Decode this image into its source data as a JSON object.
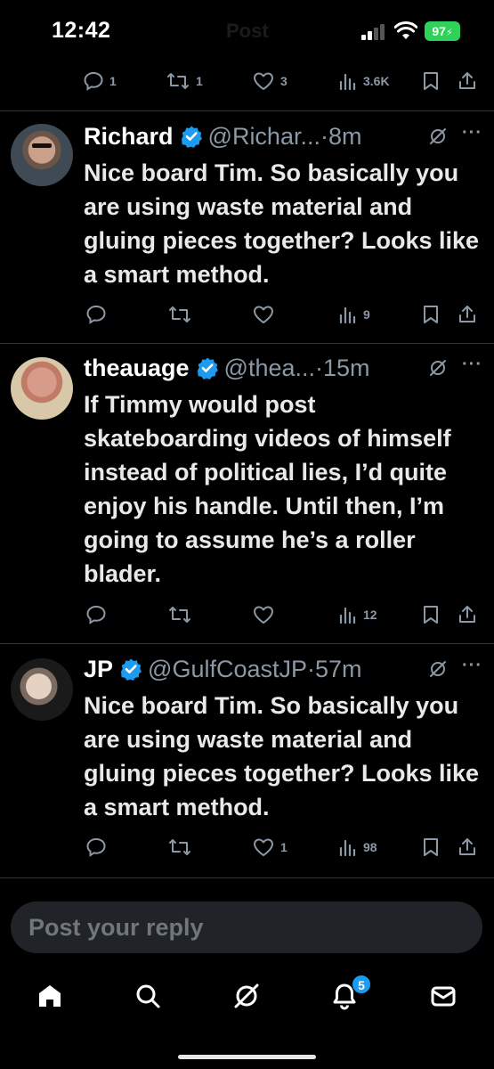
{
  "status_bar": {
    "time": "12:42",
    "ghost_title": "Post",
    "battery": "97",
    "battery_color": "#30d158"
  },
  "colors": {
    "accent": "#1d9bf0",
    "muted": "#8b98a5",
    "background": "#000000"
  },
  "top_post_actions": {
    "replies": "1",
    "reposts": "1",
    "likes": "3",
    "views": "3.6K"
  },
  "replies": [
    {
      "name": "Richard",
      "handle": "@Richar...",
      "time": "·8m",
      "text": "Nice board Tim. So basically you are using waste material and gluing pieces together? Looks like a smart method.",
      "actions": {
        "replies": "",
        "reposts": "",
        "likes": "",
        "views": "9"
      }
    },
    {
      "name": "theauage",
      "handle": "@thea...",
      "time": "·15m",
      "text": "If Timmy would post skateboarding videos of himself instead of political lies, I’d quite enjoy his handle. Until then, I’m going to assume he’s a roller blader.",
      "actions": {
        "replies": "",
        "reposts": "",
        "likes": "",
        "views": "12"
      }
    },
    {
      "name": "JP",
      "handle": "@GulfCoastJP",
      "time": "·57m",
      "text": "Nice board Tim. So basically you are using waste material and gluing pieces together? Looks like a smart method.",
      "actions": {
        "replies": "",
        "reposts": "",
        "likes": "1",
        "views": "98"
      }
    }
  ],
  "composer": {
    "placeholder": "Post your reply"
  },
  "tabbar": {
    "notifications_count": "5",
    "icons": [
      "home-icon",
      "search-icon",
      "grok-icon",
      "notifications-icon",
      "messages-icon"
    ]
  }
}
